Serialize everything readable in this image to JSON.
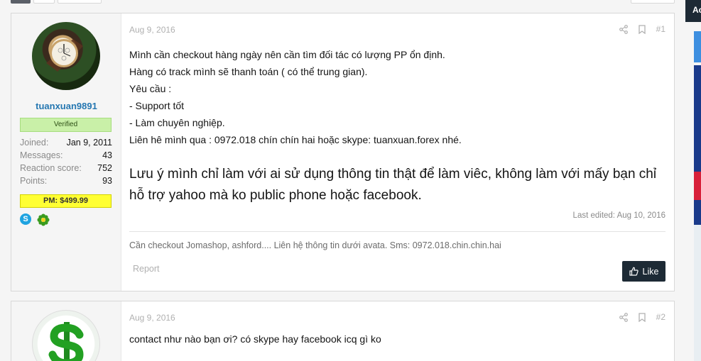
{
  "post1": {
    "username": "tuanxuan9891",
    "badge": "Verified",
    "stats": [
      {
        "k": "Joined:",
        "v": "Jan 9, 2011"
      },
      {
        "k": "Messages:",
        "v": "43"
      },
      {
        "k": "Reaction score:",
        "v": "752"
      },
      {
        "k": "Points:",
        "v": "93"
      }
    ],
    "pm": "PM: $499.99",
    "date": "Aug 9, 2016",
    "number": "#1",
    "lines": [
      "Mình cần checkout hàng ngày nên cần tìm đối tác có lượng PP ổn định.",
      "Hàng có track mình sẽ thanh toán ( có thể trung gian).",
      "Yêu cầu :",
      "- Support tốt",
      "- Làm chuyên nghiệp.",
      "Liên hê mình qua : 0972.018 chín chín hai hoặc skype: tuanxuan.forex nhé."
    ],
    "big_text": "Lưu ý mình chỉ làm với ai sử dụng thông tin thật để làm viêc, không làm với mấy bạn chỉ hỗ trợ yahoo mà ko public phone hoặc facebook.",
    "last_edited": "Last edited: Aug 10, 2016",
    "signature": "Cần checkout Jomashop, ashford.... Liên hệ thông tin dưới avata. Sms: 0972.018.chin.chin.hai",
    "report": "Report",
    "like": "Like"
  },
  "post2": {
    "date": "Aug 9, 2016",
    "number": "#2",
    "text": "contact như nào bạn ơi? có skype hay facebook icq gì ko"
  },
  "sidebar": {
    "head": "Ac"
  },
  "colors": {
    "link": "#2577b1",
    "verified_bg": "#c9f0a8",
    "pm_bg": "#ffff33",
    "button_dark": "#1d2a35"
  }
}
